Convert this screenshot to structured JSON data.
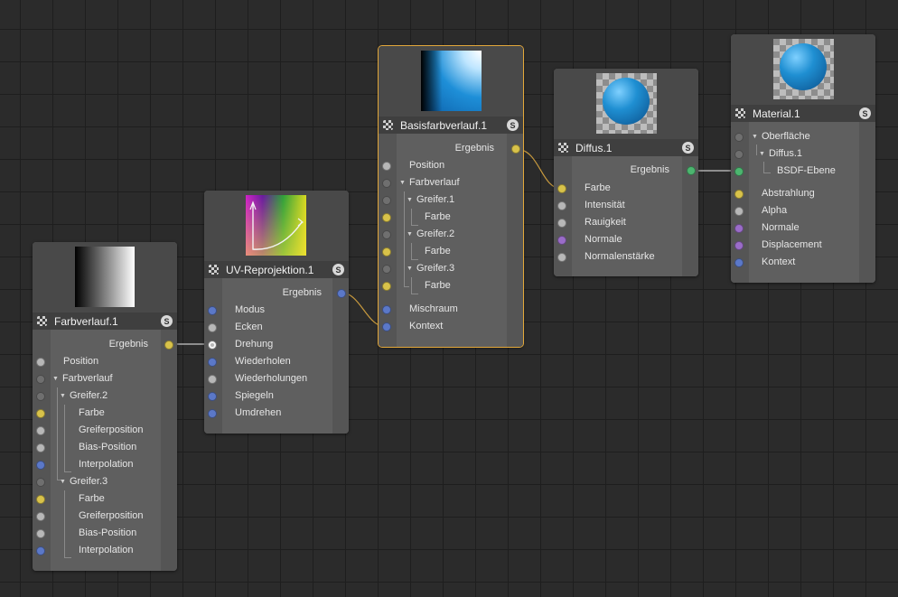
{
  "colors": {
    "yellow": "#d8c24a",
    "grey": "#b7b7b7",
    "blue": "#5b78c8",
    "purple": "#9a6cc8",
    "green": "#4cb56f",
    "wire": "#c89a3e",
    "wire_grey": "#c8c8c8",
    "selection": "#e3a83a"
  },
  "nodes": {
    "farbverlauf": {
      "title": "Farbverlauf.1",
      "s": "S",
      "rows": [
        {
          "label": "Ergebnis"
        },
        {
          "label": "Position"
        },
        {
          "label": "Farbverlauf"
        },
        {
          "label": "Greifer.2"
        },
        {
          "label": "Farbe"
        },
        {
          "label": "Greiferposition"
        },
        {
          "label": "Bias-Position"
        },
        {
          "label": "Interpolation"
        },
        {
          "label": "Greifer.3"
        },
        {
          "label": "Farbe"
        },
        {
          "label": "Greiferposition"
        },
        {
          "label": "Bias-Position"
        },
        {
          "label": "Interpolation"
        }
      ]
    },
    "uv": {
      "title": "UV-Reprojektion.1",
      "s": "S",
      "rows": [
        {
          "label": "Ergebnis"
        },
        {
          "label": "Modus"
        },
        {
          "label": "Ecken"
        },
        {
          "label": "Drehung"
        },
        {
          "label": "Wiederholen"
        },
        {
          "label": "Wiederholungen"
        },
        {
          "label": "Spiegeln"
        },
        {
          "label": "Umdrehen"
        }
      ]
    },
    "basis": {
      "title": "Basisfarbverlauf.1",
      "s": "S",
      "rows": [
        {
          "label": "Ergebnis"
        },
        {
          "label": "Position"
        },
        {
          "label": "Farbverlauf"
        },
        {
          "label": "Greifer.1"
        },
        {
          "label": "Farbe"
        },
        {
          "label": "Greifer.2"
        },
        {
          "label": "Farbe"
        },
        {
          "label": "Greifer.3"
        },
        {
          "label": "Farbe"
        },
        {
          "label": "Mischraum"
        },
        {
          "label": "Kontext"
        }
      ]
    },
    "diffus": {
      "title": "Diffus.1",
      "s": "S",
      "rows": [
        {
          "label": "Ergebnis"
        },
        {
          "label": "Farbe"
        },
        {
          "label": "Intensität"
        },
        {
          "label": "Rauigkeit"
        },
        {
          "label": "Normale"
        },
        {
          "label": "Normalenstärke"
        }
      ]
    },
    "material": {
      "title": "Material.1",
      "s": "S",
      "rows": [
        {
          "label": "Oberfläche"
        },
        {
          "label": "Diffus.1"
        },
        {
          "label": "BSDF-Ebene"
        },
        {
          "label": "Abstrahlung"
        },
        {
          "label": "Alpha"
        },
        {
          "label": "Normale"
        },
        {
          "label": "Displacement"
        },
        {
          "label": "Kontext"
        }
      ]
    }
  }
}
